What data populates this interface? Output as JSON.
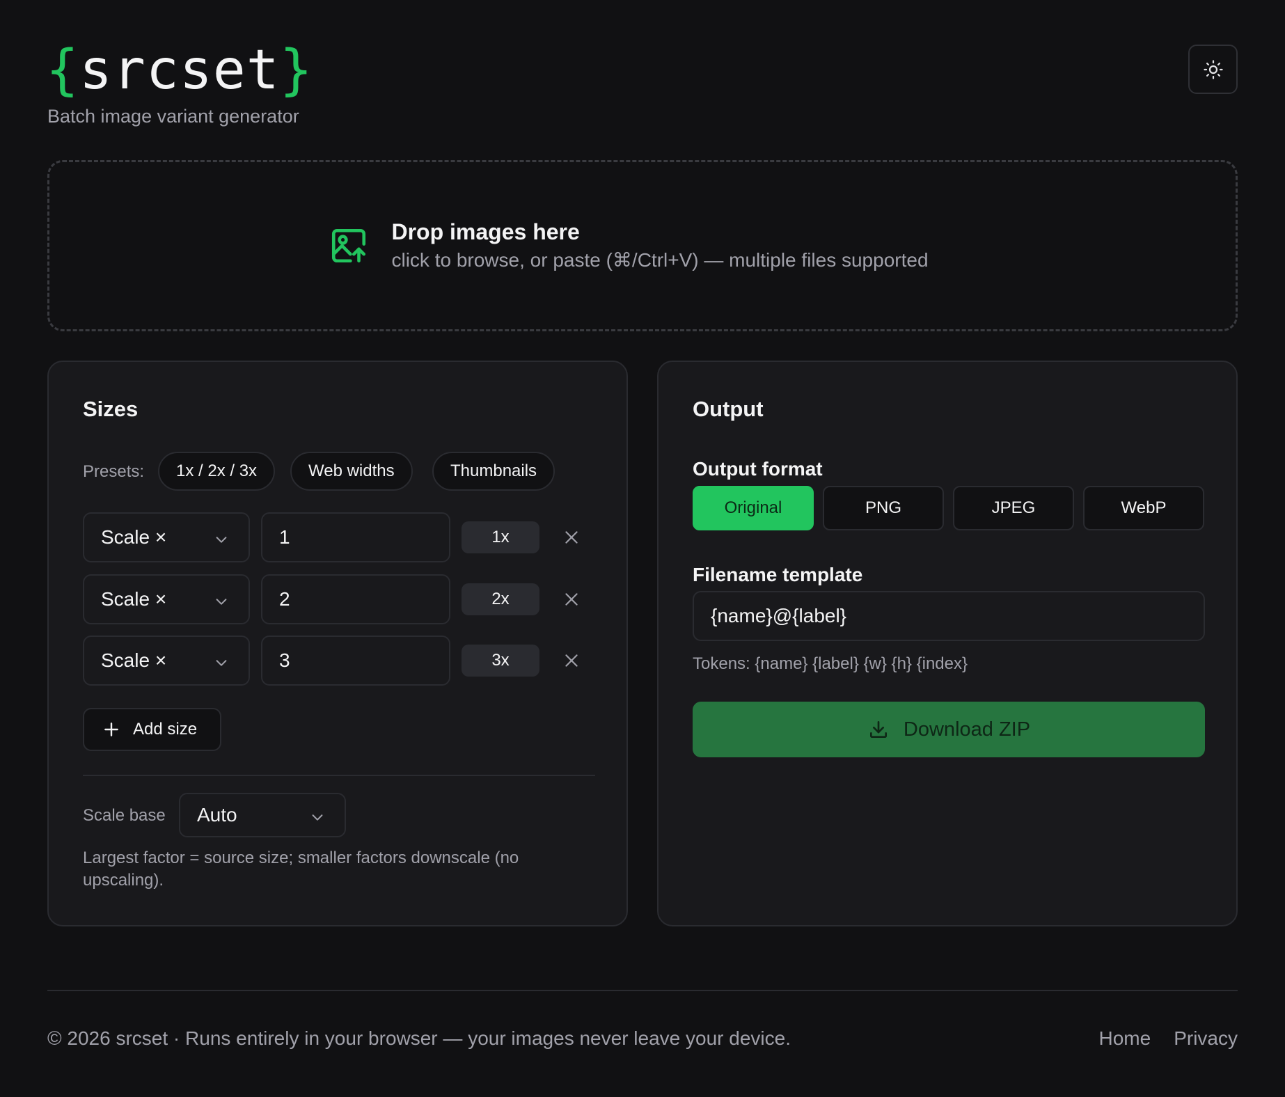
{
  "header": {
    "logo": {
      "open_brace": "{",
      "name": "srcset",
      "close_brace": "}"
    },
    "tagline": "Batch image variant generator",
    "theme_toggle_icon": "sun-icon"
  },
  "dropzone": {
    "icon": "image-upload-icon",
    "title": "Drop images here",
    "subtitle": "click to browse, or paste (⌘/Ctrl+V) — multiple files supported"
  },
  "sizes": {
    "title": "Sizes",
    "presets_label": "Presets:",
    "presets": [
      "1x / 2x / 3x",
      "Web widths",
      "Thumbnails"
    ],
    "rows": [
      {
        "mode": "Scale ×",
        "value": "1",
        "label": "1x"
      },
      {
        "mode": "Scale ×",
        "value": "2",
        "label": "2x"
      },
      {
        "mode": "Scale ×",
        "value": "3",
        "label": "3x"
      }
    ],
    "add_size_label": "Add size",
    "scale_base_label": "Scale base",
    "scale_base_value": "Auto",
    "hint": "Largest factor = source size; smaller factors downscale (no upscaling)."
  },
  "output": {
    "title": "Output",
    "format_label": "Output format",
    "formats": [
      "Original",
      "PNG",
      "JPEG",
      "WebP"
    ],
    "selected_format": "Original",
    "filename_label": "Filename template",
    "filename_value": "{name}@{label}",
    "tokens_hint": "Tokens: {name} {label} {w} {h} {index}",
    "download_label": "Download ZIP"
  },
  "footer": {
    "copyright": "© 2026 srcset · Runs entirely in your browser — your images never leave your device.",
    "links": [
      "Home",
      "Privacy"
    ]
  },
  "colors": {
    "accent": "#22c55e",
    "download_bg": "#26753f",
    "background": "#111113",
    "panel": "#19191c"
  }
}
